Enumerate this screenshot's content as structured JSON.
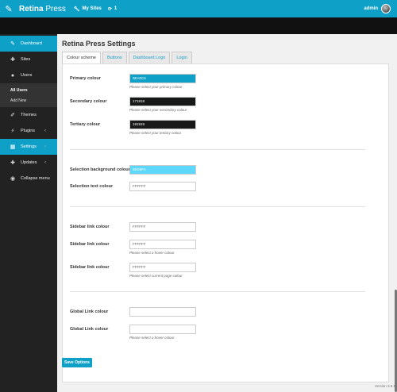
{
  "topbar": {
    "brand_bold": "Retina",
    "brand_rest": " Press",
    "my_sites": "My Sites",
    "update_count": "1",
    "user": "admin",
    "accent": "#0ea0c6"
  },
  "sidebar": {
    "items": [
      {
        "label": "Dashboard",
        "icon": "pencil-icon"
      },
      {
        "label": "Sites",
        "icon": "wrench-icon"
      },
      {
        "label": "Users",
        "icon": "user-icon"
      },
      {
        "label": "Themes",
        "icon": "brush-icon"
      },
      {
        "label": "Plugins",
        "icon": "plug-icon"
      },
      {
        "label": "Settings",
        "icon": "settings-icon"
      },
      {
        "label": "Updates",
        "icon": "wrench-icon"
      },
      {
        "label": "Collapse menu",
        "icon": "collapse-icon"
      }
    ],
    "users_submenu": [
      "All Users",
      "Add New"
    ]
  },
  "page": {
    "title": "Retina Press Settings",
    "tabs": [
      "Colour scheme",
      "Buttons",
      "Dashboard Logo",
      "Login"
    ]
  },
  "fields": {
    "primary_label": "Primary colour",
    "primary_value": "0EA0C6",
    "primary_color": "#0ea0c6",
    "primary_hint": "Please select your primary colour",
    "secondary_label": "Secondary colour",
    "secondary_value": "171818",
    "secondary_color": "#171818",
    "secondary_hint": "Please select your secondary colour",
    "tertiary_label": "Tertiary colour",
    "tertiary_value": "191919",
    "tertiary_color": "#191919",
    "tertiary_hint": "Please select your tertiary colour",
    "selbg_label": "Selection background colour",
    "selbg_value": "5ED8FA",
    "selbg_color": "#5ed8fa",
    "seltext_label": "Selection text colour",
    "seltext_value": "FFFFFF",
    "sidebar1_label": "Sidebar link colour",
    "sidebar1_value": "FFFFFF",
    "sidebar2_label": "Sidebar link colour",
    "sidebar2_value": "FFFFFF",
    "sidebar2_hint": "Please select a hover colour",
    "sidebar3_label": "Sidebar link colour",
    "sidebar3_value": "FFFFFF",
    "sidebar3_hint": "Please select current page colour",
    "global1_label": "Global Link colour",
    "global1_value": "",
    "global2_label": "Global Link colour",
    "global2_value": "",
    "global2_hint": "Please select a hover colour"
  },
  "footer": {
    "save_label": "Save Options",
    "version": "Version 3.8.1"
  }
}
